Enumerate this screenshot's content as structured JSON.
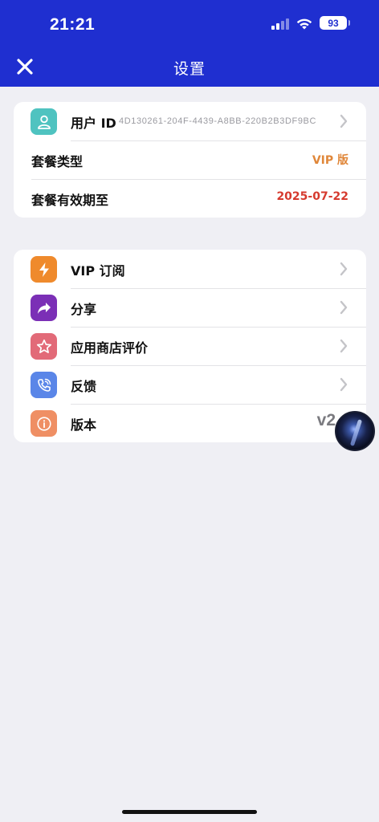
{
  "status_bar": {
    "time": "21:21",
    "battery": "93"
  },
  "header": {
    "title": "设置",
    "close_icon": "close-icon"
  },
  "account": {
    "user_id_label": "用户 ID",
    "user_id_value": "4D130261-204F-4439-A8BB-220B2B3DF9BC",
    "plan_type_label": "套餐类型",
    "plan_type_value": "VIP 版",
    "expiry_label": "套餐有效期至",
    "expiry_value": "2025-07-22"
  },
  "menu": {
    "vip": "VIP 订阅",
    "share": "分享",
    "rate": "应用商店评价",
    "feedback": "反馈",
    "version_label": "版本",
    "version_value": "v2"
  },
  "colors": {
    "header_bg": "#1f2fd0",
    "plan_value": "#e0873a",
    "expiry_value": "#d63a2e",
    "icon_user": "#4fc3c0",
    "icon_vip": "#ef8a2c",
    "icon_share": "#7b2fb6",
    "icon_rate": "#e26a78",
    "icon_feedback": "#5a86e8",
    "icon_version": "#ef8f64"
  }
}
